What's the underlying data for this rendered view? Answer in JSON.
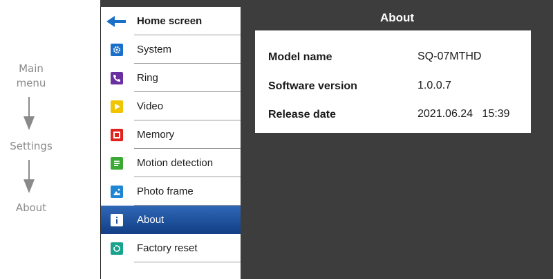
{
  "guide": {
    "step1_line1": "Main",
    "step1_line2": "menu",
    "step2": "Settings",
    "step3": "About"
  },
  "menu": {
    "home": "Home screen",
    "items": [
      {
        "label": "System",
        "icon": "gear-icon",
        "color": "#1a6fc9"
      },
      {
        "label": "Ring",
        "icon": "phone-icon",
        "color": "#6a2fa0"
      },
      {
        "label": "Video",
        "icon": "play-icon",
        "color": "#f1c400"
      },
      {
        "label": "Memory",
        "icon": "memory-icon",
        "color": "#e0211d"
      },
      {
        "label": "Motion detection",
        "icon": "motion-icon",
        "color": "#3aaa35"
      },
      {
        "label": "Photo frame",
        "icon": "photo-icon",
        "color": "#1f86d4"
      },
      {
        "label": "About",
        "icon": "info-icon",
        "color": "#ffffff"
      },
      {
        "label": "Factory reset",
        "icon": "reset-icon",
        "color": "#1aa38c"
      }
    ],
    "active_index": 6
  },
  "about": {
    "title": "About",
    "rows": [
      {
        "key": "Model name",
        "value": "SQ-07MTHD"
      },
      {
        "key": "Software version",
        "value": "1.0.0.7"
      },
      {
        "key": "Release date",
        "value": "2021.06.24   15:39"
      }
    ]
  },
  "colors": {
    "background": "#3d3d3d",
    "active_item": "#1f4f9e",
    "back_arrow": "#1a6fc9"
  }
}
